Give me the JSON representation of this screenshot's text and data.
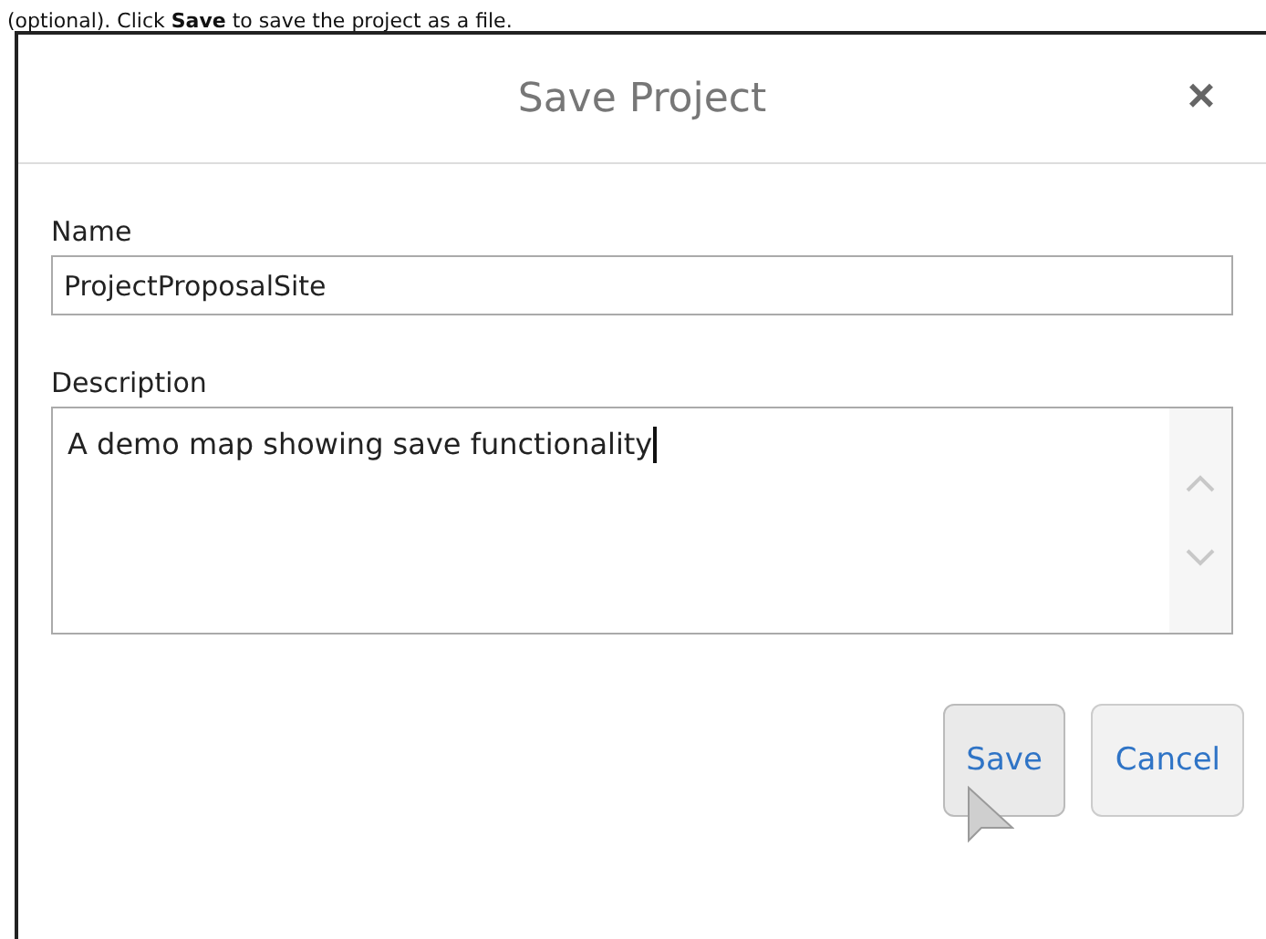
{
  "instruction": "(optional). Click **Save** to save the project as a file.",
  "dialog": {
    "title": "Save Project",
    "close": "×",
    "fields": [
      {
        "kind": "line",
        "label": "Name",
        "value": "ProjectProposalSite"
      },
      {
        "kind": "multiline",
        "label": "Description",
        "value": "A demo map showing save functionality"
      }
    ],
    "buttons": [
      {
        "label": "Save",
        "hovered": true
      },
      {
        "label": "Cancel",
        "hovered": false
      }
    ]
  }
}
